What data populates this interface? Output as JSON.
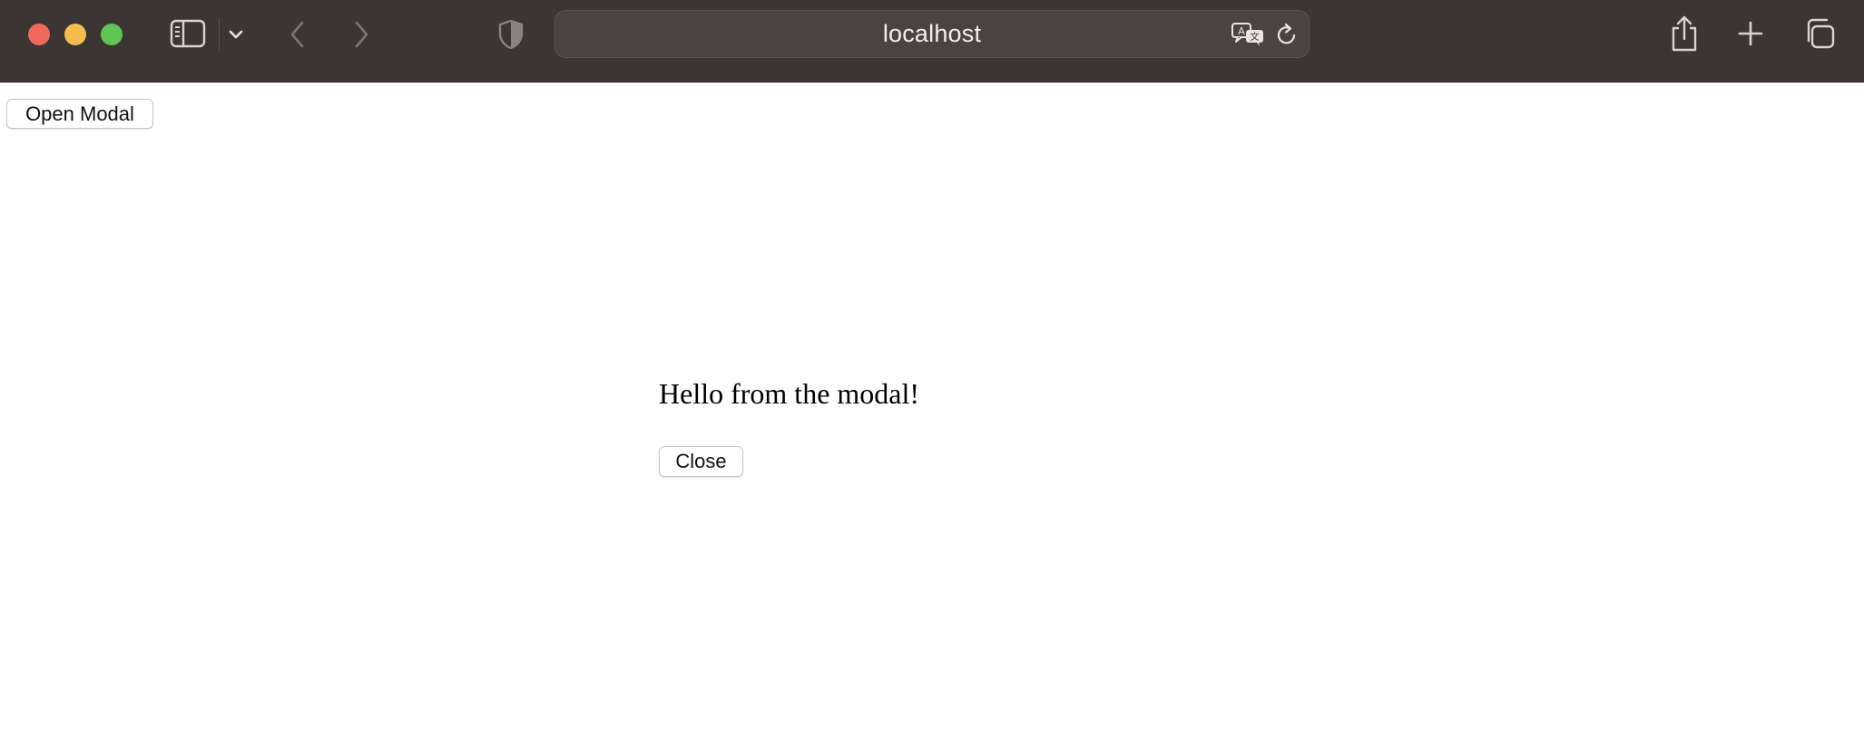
{
  "browser": {
    "address_bar": {
      "url": "localhost"
    },
    "icons": {
      "sidebar": "sidebar-icon",
      "tab_group_menu": "chevron-down-icon",
      "back": "chevron-left-icon",
      "forward": "chevron-right-icon",
      "privacy": "shield-icon",
      "translate": "translate-icon",
      "reload": "reload-icon",
      "share": "share-icon",
      "new_tab": "plus-icon",
      "tab_overview": "tabs-overview-icon"
    },
    "colors": {
      "toolbar_bg": "#3b3533",
      "close": "#ee6a5f",
      "minimize": "#f5bd4f",
      "zoom": "#61c554"
    }
  },
  "page": {
    "open_button_label": "Open Modal",
    "modal": {
      "message": "Hello from the modal!",
      "close_label": "Close"
    }
  }
}
